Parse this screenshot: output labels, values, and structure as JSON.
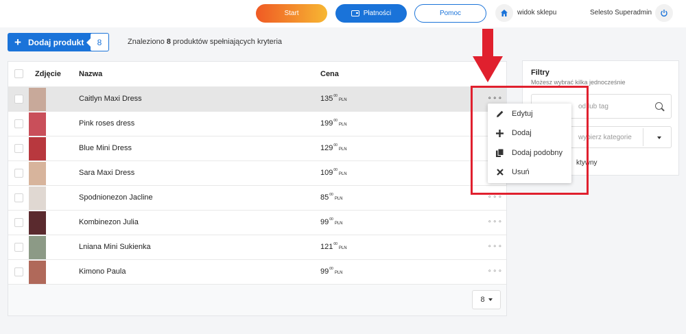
{
  "topbar": {
    "start_label": "Start",
    "platnosci_label": "Płatności",
    "pomoc_label": "Pomoc",
    "shop_view_label": "widok sklepu",
    "user_label": "Selesto Superadmin"
  },
  "header": {
    "add_product_label": "Dodaj produkt",
    "product_count": "8",
    "found_prefix": "Znaleziono ",
    "found_count": "8",
    "found_suffix": " produktów spełniających kryteria"
  },
  "table": {
    "columns": {
      "photo": "Zdjęcie",
      "name": "Nazwa",
      "price": "Cena"
    },
    "currency": "PLN",
    "rows": [
      {
        "name": "Caitlyn Maxi Dress",
        "price_int": "135",
        "price_dec": "00",
        "thumb_color": "#c8a99a"
      },
      {
        "name": "Pink roses dress",
        "price_int": "199",
        "price_dec": "00",
        "thumb_color": "#c94f5a"
      },
      {
        "name": "Blue Mini Dress",
        "price_int": "129",
        "price_dec": "00",
        "thumb_color": "#b8383e"
      },
      {
        "name": "Sara Maxi Dress",
        "price_int": "109",
        "price_dec": "00",
        "thumb_color": "#d7b49c"
      },
      {
        "name": "Spodnionezon Jacline",
        "price_int": "85",
        "price_dec": "00",
        "thumb_color": "#e0d8d2"
      },
      {
        "name": "Kombinezon Julia",
        "price_int": "99",
        "price_dec": "00",
        "thumb_color": "#5a2a2e"
      },
      {
        "name": "Lniana Mini Sukienka",
        "price_int": "121",
        "price_dec": "00",
        "thumb_color": "#8c9a86"
      },
      {
        "name": "Kimono Paula",
        "price_int": "99",
        "price_dec": "00",
        "thumb_color": "#b0695a"
      }
    ],
    "per_page": "8"
  },
  "filters": {
    "title": "Filtry",
    "subtitle": "Możesz wybrać kilka jednocześnie",
    "search_placeholder": "od lub tag",
    "category_placeholder": "wybierz kategorie",
    "active_label": "ktywny"
  },
  "menu": {
    "edit": "Edytuj",
    "add": "Dodaj",
    "add_similar": "Dodaj podobny",
    "delete": "Usuń"
  },
  "colors": {
    "primary": "#1a73d9",
    "start_gradient_from": "#ef5a24",
    "start_gradient_to": "#f7b733",
    "annotation_red": "#e0202e"
  }
}
